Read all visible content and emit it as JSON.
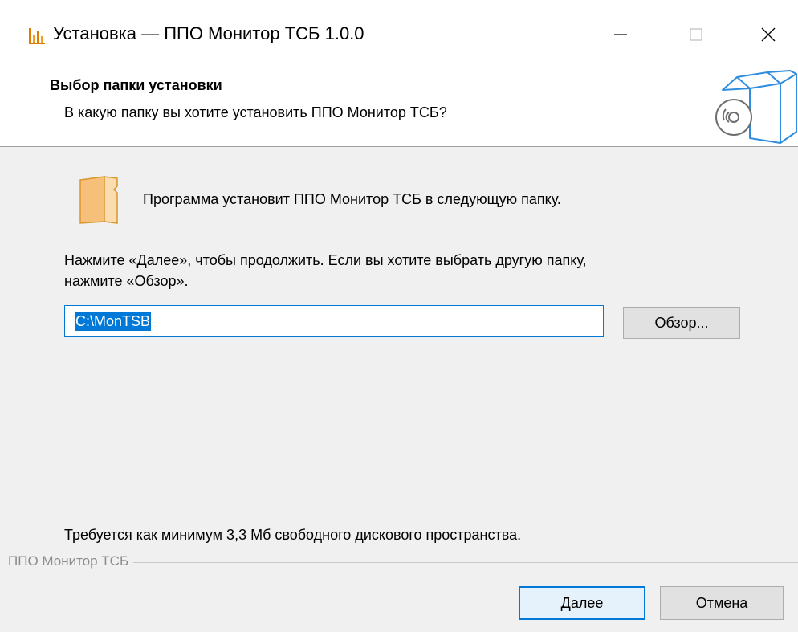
{
  "window": {
    "title": "Установка — ППО Монитор ТСБ 1.0.0",
    "minimize_label": "Свернуть",
    "maximize_label": "Развернуть",
    "close_label": "Закрыть"
  },
  "header": {
    "title": "Выбор папки установки",
    "subtitle": "В какую папку вы хотите установить ППО Монитор ТСБ?"
  },
  "body": {
    "install_text": "Программа установит ППО Монитор ТСБ в следующую папку.",
    "instruction_line1": "Нажмите «Далее», чтобы продолжить. Если вы хотите выбрать другую папку,",
    "instruction_line2": "нажмите «Обзор».",
    "path_value": "C:\\MonTSB",
    "browse_label": "Обзор...",
    "space_required": "Требуется как минимум 3,3 Мб свободного дискового пространства."
  },
  "footer": {
    "group_label": "ППО Монитор ТСБ",
    "next_label": "Далее",
    "cancel_label": "Отмена"
  },
  "colors": {
    "accent": "#0078d7",
    "folder": "#f6c07a",
    "app_icon": "#e07b00"
  },
  "icons": {
    "app": "bar-chart-icon",
    "header": "installer-box-disc-icon",
    "folder": "folder-icon"
  }
}
